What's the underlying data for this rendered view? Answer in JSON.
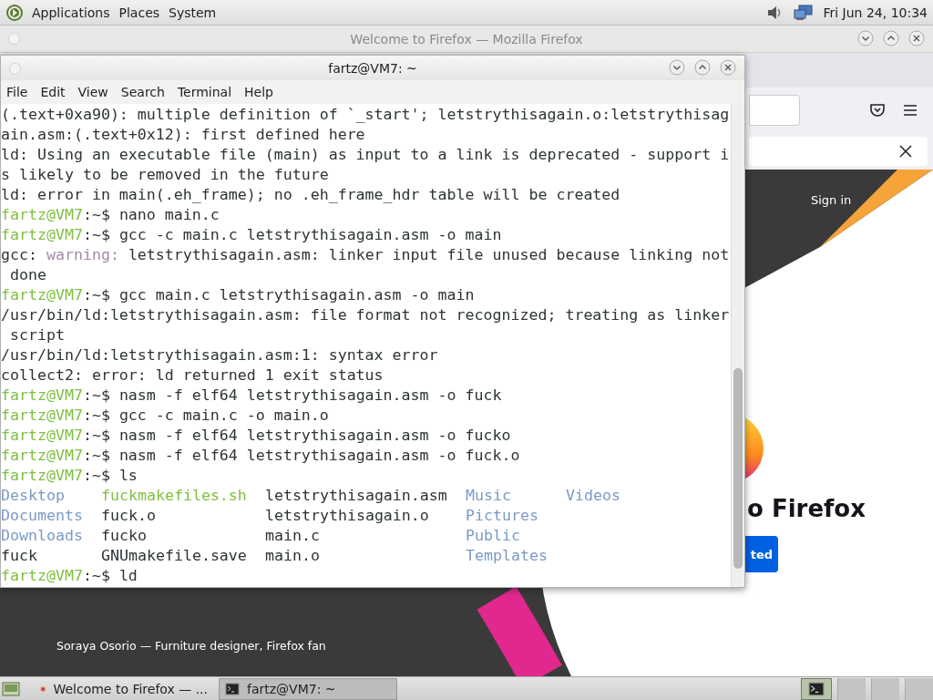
{
  "top_panel": {
    "menus": [
      "Applications",
      "Places",
      "System"
    ],
    "clock": "Fri Jun 24, 10:34"
  },
  "browser_window": {
    "title": "Welcome to Firefox — Mozilla Firefox",
    "page": {
      "sign_in": "Sign in",
      "heading": "o Firefox",
      "button": "ted",
      "caption": "Soraya Osorio — Furniture designer, Firefox fan"
    }
  },
  "terminal_window": {
    "title": "fartz@VM7: ~",
    "menu": [
      "File",
      "Edit",
      "View",
      "Search",
      "Terminal",
      "Help"
    ],
    "lines": [
      {
        "kind": "text",
        "segments": [
          {
            "kind": "plain",
            "text": "(.text+0xa90): multiple definition of `_start'; letstrythisagain.o:letstrythisag"
          }
        ]
      },
      {
        "kind": "text",
        "segments": [
          {
            "kind": "plain",
            "text": "ain.asm:(.text+0x12): first defined here"
          }
        ]
      },
      {
        "kind": "text",
        "segments": [
          {
            "kind": "plain",
            "text": "ld: Using an executable file (main) as input to a link is deprecated - support i"
          }
        ]
      },
      {
        "kind": "text",
        "segments": [
          {
            "kind": "plain",
            "text": "s likely to be removed in the future"
          }
        ]
      },
      {
        "kind": "text",
        "segments": [
          {
            "kind": "plain",
            "text": "ld: error in main(.eh_frame); no .eh_frame_hdr table will be created"
          }
        ]
      },
      {
        "kind": "text",
        "segments": [
          {
            "kind": "prompt",
            "text": "fartz@VM7"
          },
          {
            "kind": "plain",
            "text": ":~$ nano main.c"
          }
        ]
      },
      {
        "kind": "text",
        "segments": [
          {
            "kind": "prompt",
            "text": "fartz@VM7"
          },
          {
            "kind": "plain",
            "text": ":~$ gcc -c main.c letstrythisagain.asm -o main"
          }
        ]
      },
      {
        "kind": "text",
        "segments": [
          {
            "kind": "plain",
            "text": "gcc: "
          },
          {
            "kind": "warning",
            "text": "warning:"
          },
          {
            "kind": "plain",
            "text": " letstrythisagain.asm: linker input file unused because linking not"
          }
        ]
      },
      {
        "kind": "text",
        "segments": [
          {
            "kind": "plain",
            "text": " done"
          }
        ]
      },
      {
        "kind": "text",
        "segments": [
          {
            "kind": "prompt",
            "text": "fartz@VM7"
          },
          {
            "kind": "plain",
            "text": ":~$ gcc main.c letstrythisagain.asm -o main"
          }
        ]
      },
      {
        "kind": "text",
        "segments": [
          {
            "kind": "plain",
            "text": "/usr/bin/ld:letstrythisagain.asm: file format not recognized; treating as linker"
          }
        ]
      },
      {
        "kind": "text",
        "segments": [
          {
            "kind": "plain",
            "text": " script"
          }
        ]
      },
      {
        "kind": "text",
        "segments": [
          {
            "kind": "plain",
            "text": "/usr/bin/ld:letstrythisagain.asm:1: syntax error"
          }
        ]
      },
      {
        "kind": "text",
        "segments": [
          {
            "kind": "plain",
            "text": "collect2: error: ld returned 1 exit status"
          }
        ]
      },
      {
        "kind": "text",
        "segments": [
          {
            "kind": "prompt",
            "text": "fartz@VM7"
          },
          {
            "kind": "plain",
            "text": ":~$ nasm -f elf64 letstrythisagain.asm -o fuck"
          }
        ]
      },
      {
        "kind": "text",
        "segments": [
          {
            "kind": "prompt",
            "text": "fartz@VM7"
          },
          {
            "kind": "plain",
            "text": ":~$ gcc -c main.c -o main.o"
          }
        ]
      },
      {
        "kind": "text",
        "segments": [
          {
            "kind": "prompt",
            "text": "fartz@VM7"
          },
          {
            "kind": "plain",
            "text": ":~$ nasm -f elf64 letstrythisagain.asm -o fucko"
          }
        ]
      },
      {
        "kind": "text",
        "segments": [
          {
            "kind": "prompt",
            "text": "fartz@VM7"
          },
          {
            "kind": "plain",
            "text": ":~$ nasm -f elf64 letstrythisagain.asm -o fuck.o"
          }
        ]
      },
      {
        "kind": "text",
        "segments": [
          {
            "kind": "prompt",
            "text": "fartz@VM7"
          },
          {
            "kind": "plain",
            "text": ":~$ ls"
          }
        ]
      },
      {
        "kind": "listing",
        "cells": [
          {
            "kind": "dir",
            "name": "Desktop"
          },
          {
            "kind": "exec",
            "name": "fuckmakefiles.sh"
          },
          {
            "kind": "file",
            "name": "letstrythisagain.asm"
          },
          {
            "kind": "dir",
            "name": "Music"
          },
          {
            "kind": "dir",
            "name": "Videos"
          }
        ]
      },
      {
        "kind": "listing",
        "cells": [
          {
            "kind": "dir",
            "name": "Documents"
          },
          {
            "kind": "file",
            "name": "fuck.o"
          },
          {
            "kind": "file",
            "name": "letstrythisagain.o"
          },
          {
            "kind": "dir",
            "name": "Pictures"
          }
        ]
      },
      {
        "kind": "listing",
        "cells": [
          {
            "kind": "dir",
            "name": "Downloads"
          },
          {
            "kind": "file",
            "name": "fucko"
          },
          {
            "kind": "file",
            "name": "main.c"
          },
          {
            "kind": "dir",
            "name": "Public"
          }
        ]
      },
      {
        "kind": "listing",
        "cells": [
          {
            "kind": "file",
            "name": "fuck"
          },
          {
            "kind": "file",
            "name": "GNUmakefile.save"
          },
          {
            "kind": "file",
            "name": "main.o"
          },
          {
            "kind": "dir",
            "name": "Templates"
          }
        ]
      },
      {
        "kind": "text",
        "segments": [
          {
            "kind": "prompt",
            "text": "fartz@VM7"
          },
          {
            "kind": "plain",
            "text": ":~$ ld"
          }
        ]
      }
    ]
  },
  "taskbar": {
    "tasks": [
      {
        "kind": "browser",
        "label": "Welcome to Firefox — ...",
        "selected": false
      },
      {
        "kind": "terminal",
        "label": "fartz@VM7: ~",
        "selected": true
      }
    ]
  }
}
